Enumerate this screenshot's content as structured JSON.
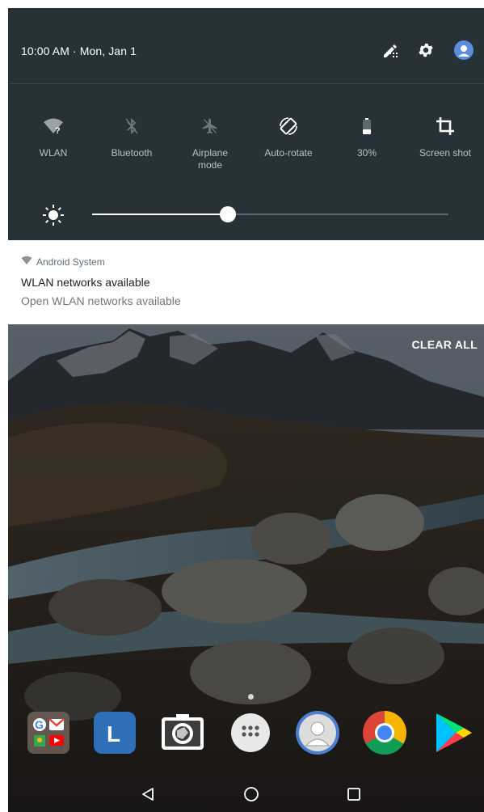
{
  "status": {
    "datetime": "10:00 AM · Mon, Jan 1",
    "header_icons": [
      "edit-icon",
      "gear-icon",
      "account-icon"
    ]
  },
  "quick_settings": {
    "tiles": [
      {
        "label": "WLAN",
        "icon": "wifi-question-icon",
        "active": true
      },
      {
        "label": "Bluetooth",
        "icon": "bluetooth-off-icon",
        "active": false
      },
      {
        "label": "Airplane mode",
        "icon": "airplane-icon",
        "active": false
      },
      {
        "label": "Auto-rotate",
        "icon": "auto-rotate-icon",
        "active": true
      },
      {
        "label": "30%",
        "icon": "battery-icon",
        "active": true
      },
      {
        "label": "Screen shot",
        "icon": "crop-icon",
        "active": true
      }
    ],
    "brightness": {
      "level": 0.38,
      "icon": "brightness-icon"
    }
  },
  "notification": {
    "app_name": "Android System",
    "app_icon": "wifi-icon",
    "title": "WLAN networks available",
    "text": "Open WLAN networks available"
  },
  "clear_all": "CLEAR ALL",
  "dock": [
    "google-apps-folder-icon",
    "l-app-icon",
    "camera-icon",
    "app-drawer-icon",
    "contacts-icon",
    "chrome-icon",
    "play-store-icon"
  ],
  "nav": [
    "back-icon",
    "home-icon",
    "recents-icon"
  ],
  "colors": {
    "panel": "#263238",
    "accent_active": "#ffffff",
    "inactive": "#8a959b"
  }
}
